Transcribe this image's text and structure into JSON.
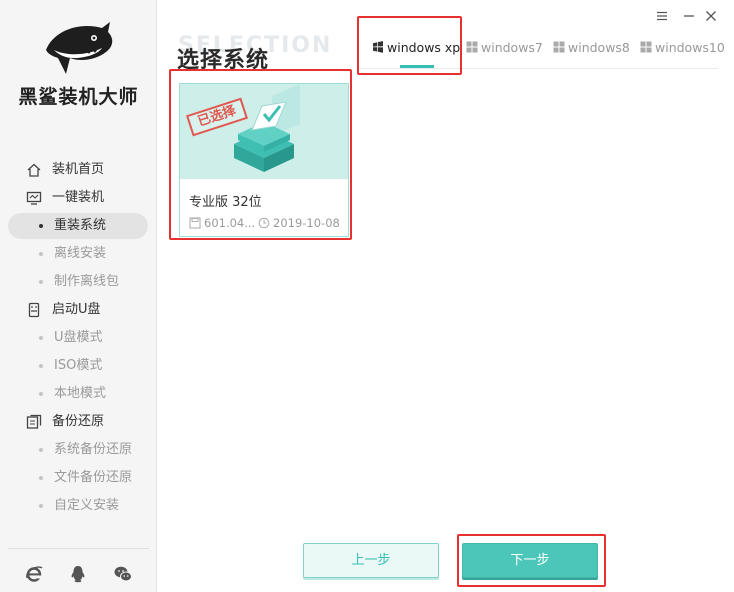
{
  "app": {
    "brand": "黑鲨装机大师"
  },
  "sidebar": {
    "items": [
      {
        "type": "group",
        "label": "装机首页",
        "icon": "home-icon"
      },
      {
        "type": "group",
        "label": "一键装机",
        "icon": "monitor-icon"
      },
      {
        "type": "sub",
        "label": "重装系统",
        "active": true
      },
      {
        "type": "sub",
        "label": "离线安装"
      },
      {
        "type": "sub",
        "label": "制作离线包"
      },
      {
        "type": "group",
        "label": "启动U盘",
        "icon": "usb-icon"
      },
      {
        "type": "sub",
        "label": "U盘模式"
      },
      {
        "type": "sub",
        "label": "ISO模式"
      },
      {
        "type": "sub",
        "label": "本地模式"
      },
      {
        "type": "group",
        "label": "备份还原",
        "icon": "backup-icon"
      },
      {
        "type": "sub",
        "label": "系统备份还原"
      },
      {
        "type": "sub",
        "label": "文件备份还原"
      },
      {
        "type": "sub",
        "label": "自定义安装"
      }
    ],
    "bottom_icons": [
      "ie-browser-icon",
      "qq-icon",
      "wechat-icon"
    ]
  },
  "main": {
    "title": "选择系统",
    "watermark": "SELECTION",
    "tabs": [
      {
        "label": "windows xp",
        "active": true
      },
      {
        "label": "windows7",
        "active": false
      },
      {
        "label": "windows8",
        "active": false
      },
      {
        "label": "windows10",
        "active": false
      }
    ],
    "card": {
      "stamp": "已选择",
      "title": "专业版 32位",
      "size": "601.04...",
      "date": "2019-10-08"
    }
  },
  "buttons": {
    "prev": "上一步",
    "next": "下一步"
  },
  "colors": {
    "accent": "#4dc6ba",
    "highlight": "#e8302f",
    "sidebar_bg": "#f5f5f5"
  }
}
